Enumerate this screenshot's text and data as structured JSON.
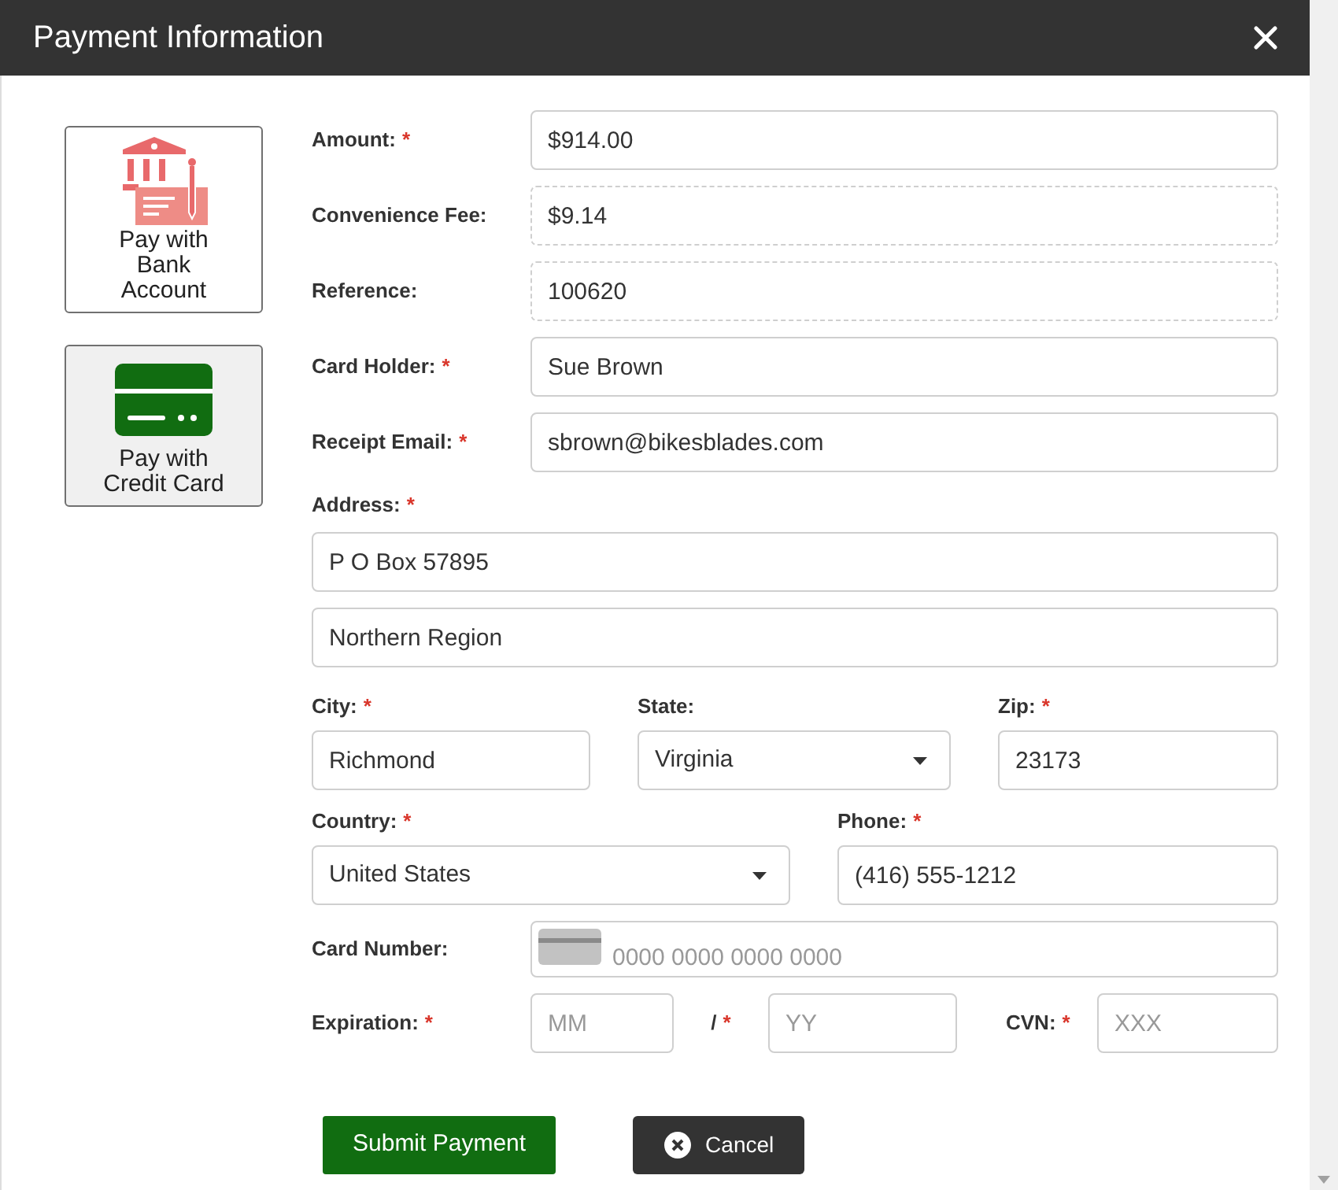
{
  "window": {
    "title": "Payment Information"
  },
  "required_marker": "*",
  "payment_methods": [
    {
      "kind": "bank",
      "label": "Pay with Bank Account",
      "selected": false
    },
    {
      "kind": "card",
      "label": "Pay with Credit Card",
      "selected": true
    }
  ],
  "inline_fields": [
    {
      "label": "Amount:",
      "required": true,
      "value": "$914.00",
      "readonly": false
    },
    {
      "label": "Convenience Fee:",
      "required": false,
      "value": "$9.14",
      "readonly": true
    },
    {
      "label": "Reference:",
      "required": false,
      "value": "100620",
      "readonly": true
    },
    {
      "label": "Card Holder:",
      "required": true,
      "value": "Sue Brown",
      "readonly": false
    },
    {
      "label": "Receipt Email:",
      "required": true,
      "value": "sbrown@bikesblades.com",
      "readonly": false
    }
  ],
  "address": {
    "label": "Address:",
    "required": true,
    "lines": [
      "P O Box 57895",
      "Northern Region"
    ]
  },
  "city_state_zip": [
    {
      "kind": "text",
      "label": "City:",
      "required": true,
      "value": "Richmond"
    },
    {
      "kind": "select",
      "label": "State:",
      "required": false,
      "value": "Virginia"
    },
    {
      "kind": "text",
      "label": "Zip:",
      "required": true,
      "value": "23173"
    }
  ],
  "country_phone": [
    {
      "kind": "select",
      "label": "Country:",
      "required": true,
      "value": "United States"
    },
    {
      "kind": "text",
      "label": "Phone:",
      "required": true,
      "value": "(416) 555-1212"
    }
  ],
  "card_number": {
    "label": "Card Number:",
    "required": false,
    "placeholder": "0000 0000 0000 0000"
  },
  "expiration": {
    "label": "Expiration:",
    "required": true,
    "month_placeholder": "MM",
    "separator": "/",
    "separator_required": true,
    "year_placeholder": "YY"
  },
  "cvn": {
    "label": "CVN:",
    "required": true,
    "placeholder": "XXX"
  },
  "buttons": [
    {
      "kind": "submit",
      "label": "Submit Payment"
    },
    {
      "kind": "cancel",
      "label": "Cancel"
    }
  ]
}
